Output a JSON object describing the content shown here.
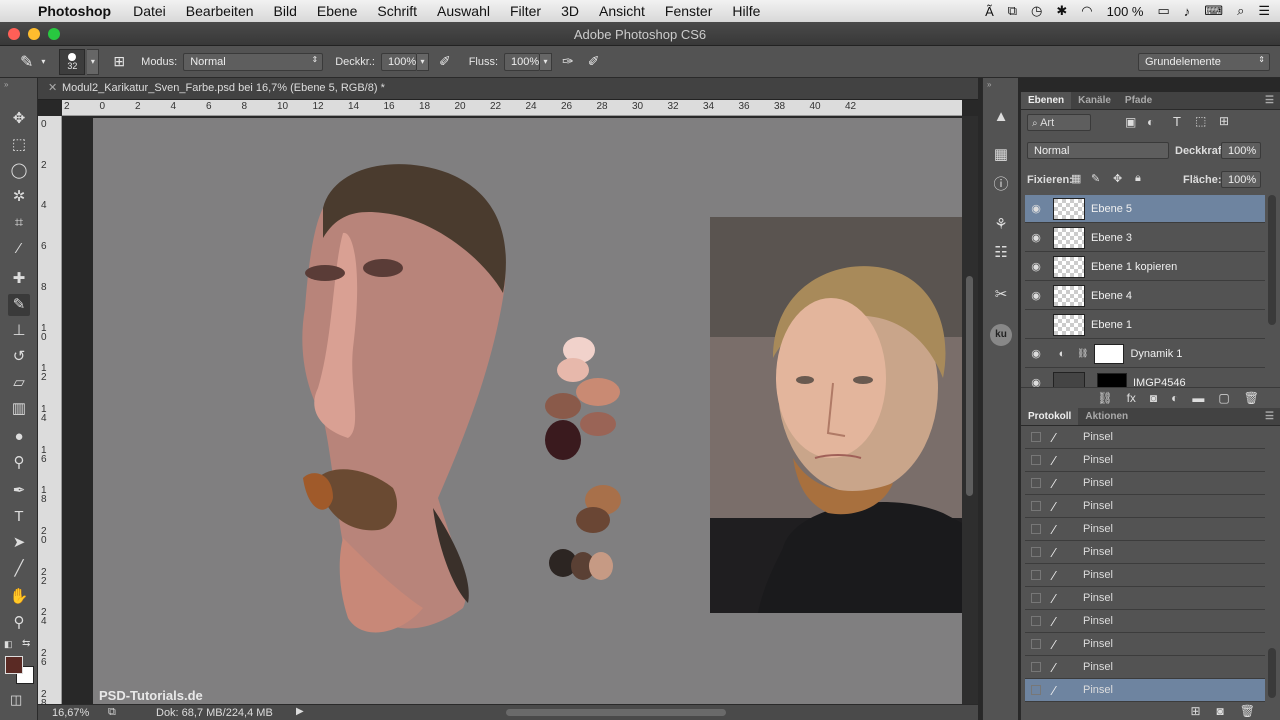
{
  "menubar": {
    "app_name": "Photoshop",
    "items": [
      "Datei",
      "Bearbeiten",
      "Bild",
      "Ebene",
      "Schrift",
      "Auswahl",
      "Filter",
      "3D",
      "Ansicht",
      "Fenster",
      "Hilfe"
    ],
    "battery": "100 %"
  },
  "window": {
    "title": "Adobe Photoshop CS6"
  },
  "options": {
    "brush_size": "32",
    "mode_label": "Modus:",
    "mode_value": "Normal",
    "opacity_label": "Deckkr.:",
    "opacity_value": "100%",
    "flow_label": "Fluss:",
    "flow_value": "100%",
    "workspace": "Grundelemente"
  },
  "document": {
    "tab": "Modul2_Karikatur_Sven_Farbe.psd bei 16,7% (Ebene 5, RGB/8) *",
    "ruler_h": [
      "2",
      "0",
      "2",
      "4",
      "6",
      "8",
      "10",
      "12",
      "14",
      "16",
      "18",
      "20",
      "22",
      "24",
      "26",
      "28",
      "30",
      "32",
      "34",
      "36",
      "38",
      "40",
      "42"
    ],
    "ruler_v": [
      "0",
      "2",
      "4",
      "6",
      "8",
      "10",
      "12",
      "14",
      "16",
      "18",
      "20",
      "22",
      "24",
      "26",
      "28"
    ],
    "zoom": "16,67%",
    "doc_info": "Dok: 68,7 MB/224,4 MB",
    "watermark": "PSD-Tutorials.de"
  },
  "layers_panel": {
    "tabs": [
      "Ebenen",
      "Kanäle",
      "Pfade"
    ],
    "filter": "Art",
    "blend_mode": "Normal",
    "opacity_label": "Deckkraft:",
    "opacity_value": "100%",
    "lock_label": "Fixieren:",
    "fill_label": "Fläche:",
    "fill_value": "100%",
    "layers": [
      {
        "name": "Ebene 5",
        "visible": true,
        "selected": true
      },
      {
        "name": "Ebene 3",
        "visible": true,
        "selected": false
      },
      {
        "name": "Ebene 1 kopieren",
        "visible": true,
        "selected": false
      },
      {
        "name": "Ebene 4",
        "visible": true,
        "selected": false
      },
      {
        "name": "Ebene 1",
        "visible": false,
        "selected": false
      },
      {
        "name": "Dynamik 1",
        "visible": true,
        "selected": false
      },
      {
        "name": "IMGP4546",
        "visible": true,
        "selected": false
      }
    ]
  },
  "history_panel": {
    "tabs": [
      "Protokoll",
      "Aktionen"
    ],
    "items": [
      "Pinsel",
      "Pinsel",
      "Pinsel",
      "Pinsel",
      "Pinsel",
      "Pinsel",
      "Pinsel",
      "Pinsel",
      "Pinsel",
      "Pinsel",
      "Pinsel",
      "Pinsel"
    ],
    "selected_index": 11
  },
  "colors": {
    "foreground": "#5a2a24",
    "background": "#ffffff",
    "selection": "#6e84a0",
    "canvas": "#807f80"
  }
}
